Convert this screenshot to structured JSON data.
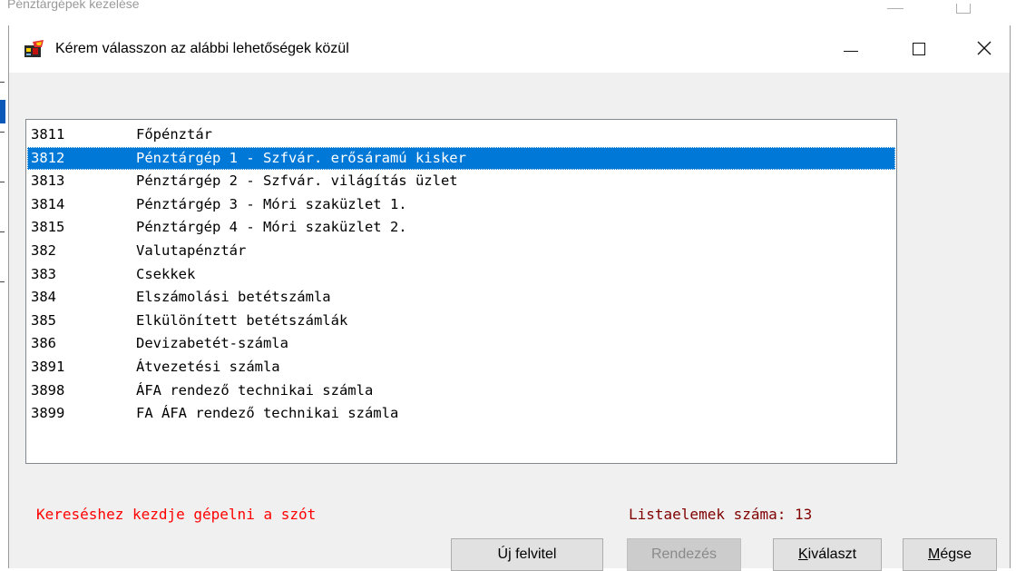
{
  "background_window": {
    "title": "Pénztárgépek kezelése"
  },
  "dialog": {
    "title": "Kérem válasszon az alábbi lehetőségek közül",
    "icon": "app-icon"
  },
  "list": {
    "selected_index": 1,
    "items": [
      {
        "code": "3811",
        "name": "Főpénztár"
      },
      {
        "code": "3812",
        "name": "Pénztárgép 1 - Szfvár. erősáramú kisker"
      },
      {
        "code": "3813",
        "name": "Pénztárgép 2 - Szfvár. világítás üzlet"
      },
      {
        "code": "3814",
        "name": "Pénztárgép 3 - Móri szaküzlet 1."
      },
      {
        "code": "3815",
        "name": "Pénztárgép 4 - Móri szaküzlet 2."
      },
      {
        "code": "382",
        "name": "Valutapénztár"
      },
      {
        "code": "383",
        "name": "Csekkek"
      },
      {
        "code": "384",
        "name": "Elszámolási betétszámla"
      },
      {
        "code": "385",
        "name": "Elkülönített betétszámlák"
      },
      {
        "code": "386",
        "name": "Devizabetét-számla"
      },
      {
        "code": "3891",
        "name": "Átvezetési számla"
      },
      {
        "code": "3898",
        "name": "ÁFA rendező technikai számla"
      },
      {
        "code": "3899",
        "name": "FA ÁFA rendező technikai számla"
      }
    ]
  },
  "status": {
    "search_hint": "Kereséshez kezdje gépelni a szót",
    "count_text": "Listaelemek száma: 13"
  },
  "buttons": {
    "new_record": "Új felvitel",
    "sort": "Rendezés",
    "select_prefix": "K",
    "select_rest": "iválaszt",
    "cancel_prefix": "M",
    "cancel_rest": "égse"
  },
  "colors": {
    "selection": "#0078d7",
    "hint": "#ff0000",
    "count": "#800000"
  }
}
